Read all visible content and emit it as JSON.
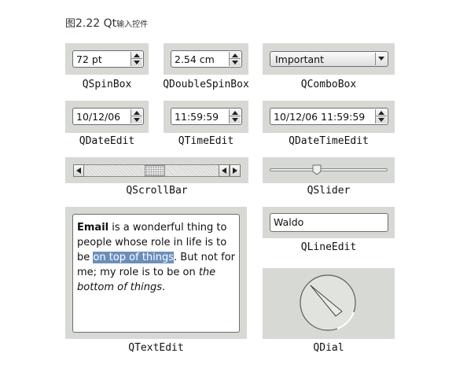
{
  "caption": {
    "prefix": "图",
    "number": "2.22 Qt",
    "text": "输入控件"
  },
  "widgets": {
    "spinbox": {
      "value": "72 pt",
      "label": "QSpinBox"
    },
    "doublespinbox": {
      "value": "2.54 cm",
      "label": "QDoubleSpinBox"
    },
    "combobox": {
      "value": "Important",
      "label": "QComboBox"
    },
    "dateedit": {
      "value": "10/12/06",
      "label": "QDateEdit"
    },
    "timeedit": {
      "value": "11:59:59",
      "label": "QTimeEdit"
    },
    "datetimeedit": {
      "value": "10/12/06 11:59:59",
      "label": "QDateTimeEdit"
    },
    "scrollbar": {
      "label": "QScrollBar",
      "position": 0.45
    },
    "slider": {
      "label": "QSlider",
      "position": 0.4
    },
    "textedit": {
      "label": "QTextEdit",
      "bold": "Email",
      "text1": " is a wonderful thing to people whose role in life is to be ",
      "selected": "on top of things",
      "text2": ". But not for me; my role is to be on ",
      "italic": "the bottom of things",
      "text3": "."
    },
    "lineedit": {
      "value": "Waldo",
      "label": "QLineEdit"
    },
    "dial": {
      "label": "QDial"
    }
  }
}
